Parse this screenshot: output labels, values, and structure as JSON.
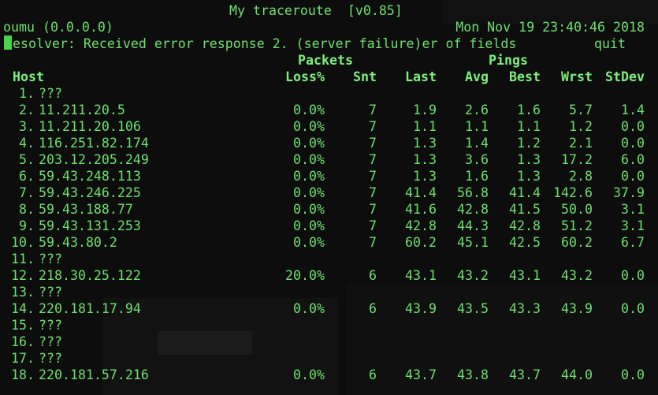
{
  "title": "My traceroute  [v0.85]",
  "host_label": "oumu (0.0.0.0)",
  "datetime": "Mon Nov 19 23:40:46 2018",
  "status_line": "esolver: Received error response 2. (server failure)er of fields",
  "quit_label": "quit",
  "group_headers": {
    "packets": "Packets",
    "pings": "Pings"
  },
  "columns": {
    "host": "Host",
    "loss": "Loss%",
    "snt": "Snt",
    "last": "Last",
    "avg": "Avg",
    "best": "Best",
    "wrst": "Wrst",
    "stdev": "StDev"
  },
  "rows": [
    {
      "n": "1.",
      "host": "???",
      "loss": "",
      "snt": "",
      "last": "",
      "avg": "",
      "best": "",
      "wrst": "",
      "stdev": ""
    },
    {
      "n": "2.",
      "host": "11.211.20.5",
      "loss": "0.0%",
      "snt": "7",
      "last": "1.9",
      "avg": "2.6",
      "best": "1.6",
      "wrst": "5.7",
      "stdev": "1.4"
    },
    {
      "n": "3.",
      "host": "11.211.20.106",
      "loss": "0.0%",
      "snt": "7",
      "last": "1.1",
      "avg": "1.1",
      "best": "1.1",
      "wrst": "1.2",
      "stdev": "0.0"
    },
    {
      "n": "4.",
      "host": "116.251.82.174",
      "loss": "0.0%",
      "snt": "7",
      "last": "1.3",
      "avg": "1.4",
      "best": "1.2",
      "wrst": "2.1",
      "stdev": "0.0"
    },
    {
      "n": "5.",
      "host": "203.12.205.249",
      "loss": "0.0%",
      "snt": "7",
      "last": "1.3",
      "avg": "3.6",
      "best": "1.3",
      "wrst": "17.2",
      "stdev": "6.0"
    },
    {
      "n": "6.",
      "host": "59.43.248.113",
      "loss": "0.0%",
      "snt": "7",
      "last": "1.3",
      "avg": "1.6",
      "best": "1.3",
      "wrst": "2.8",
      "stdev": "0.0"
    },
    {
      "n": "7.",
      "host": "59.43.246.225",
      "loss": "0.0%",
      "snt": "7",
      "last": "41.4",
      "avg": "56.8",
      "best": "41.4",
      "wrst": "142.6",
      "stdev": "37.9"
    },
    {
      "n": "8.",
      "host": "59.43.188.77",
      "loss": "0.0%",
      "snt": "7",
      "last": "41.6",
      "avg": "42.8",
      "best": "41.5",
      "wrst": "50.0",
      "stdev": "3.1"
    },
    {
      "n": "9.",
      "host": "59.43.131.253",
      "loss": "0.0%",
      "snt": "7",
      "last": "42.8",
      "avg": "44.3",
      "best": "42.8",
      "wrst": "51.2",
      "stdev": "3.1"
    },
    {
      "n": "10.",
      "host": "59.43.80.2",
      "loss": "0.0%",
      "snt": "7",
      "last": "60.2",
      "avg": "45.1",
      "best": "42.5",
      "wrst": "60.2",
      "stdev": "6.7"
    },
    {
      "n": "11.",
      "host": "???",
      "loss": "",
      "snt": "",
      "last": "",
      "avg": "",
      "best": "",
      "wrst": "",
      "stdev": ""
    },
    {
      "n": "12.",
      "host": "218.30.25.122",
      "loss": "20.0%",
      "snt": "6",
      "last": "43.1",
      "avg": "43.2",
      "best": "43.1",
      "wrst": "43.2",
      "stdev": "0.0"
    },
    {
      "n": "13.",
      "host": "???",
      "loss": "",
      "snt": "",
      "last": "",
      "avg": "",
      "best": "",
      "wrst": "",
      "stdev": ""
    },
    {
      "n": "14.",
      "host": "220.181.17.94",
      "loss": "0.0%",
      "snt": "6",
      "last": "43.9",
      "avg": "43.5",
      "best": "43.3",
      "wrst": "43.9",
      "stdev": "0.0"
    },
    {
      "n": "15.",
      "host": "???",
      "loss": "",
      "snt": "",
      "last": "",
      "avg": "",
      "best": "",
      "wrst": "",
      "stdev": ""
    },
    {
      "n": "16.",
      "host": "???",
      "loss": "",
      "snt": "",
      "last": "",
      "avg": "",
      "best": "",
      "wrst": "",
      "stdev": ""
    },
    {
      "n": "17.",
      "host": "???",
      "loss": "",
      "snt": "",
      "last": "",
      "avg": "",
      "best": "",
      "wrst": "",
      "stdev": ""
    },
    {
      "n": "18.",
      "host": "220.181.57.216",
      "loss": "0.0%",
      "snt": "6",
      "last": "43.7",
      "avg": "43.8",
      "best": "43.7",
      "wrst": "44.0",
      "stdev": "0.0"
    }
  ],
  "colors": {
    "text": "#6ee06e",
    "background": "#0b0b0b",
    "cursor": "#4ad24a"
  }
}
